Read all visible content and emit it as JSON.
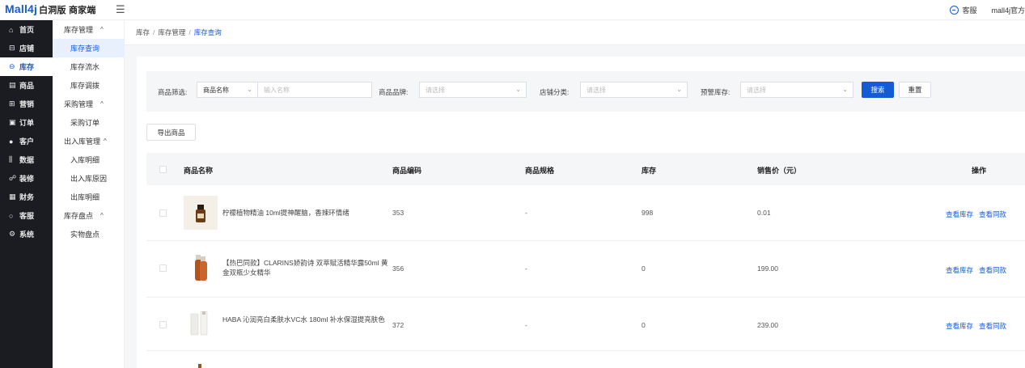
{
  "header": {
    "logo_brand": "Mall4j",
    "logo_sub": "白洞版 商家端",
    "menu_icon": "☰",
    "service_label": "客服",
    "user_name": "mall4j官方"
  },
  "sidebar": {
    "items": [
      {
        "icon": "⌂",
        "label": "首页",
        "active": false
      },
      {
        "icon": "⊟",
        "label": "店铺",
        "active": false
      },
      {
        "icon": "⊖",
        "label": "库存",
        "active": true
      },
      {
        "icon": "▤",
        "label": "商品",
        "active": false
      },
      {
        "icon": "⊞",
        "label": "营销",
        "active": false
      },
      {
        "icon": "▣",
        "label": "订单",
        "active": false
      },
      {
        "icon": "●",
        "label": "客户",
        "active": false
      },
      {
        "icon": "⫼",
        "label": "数据",
        "active": false
      },
      {
        "icon": "☍",
        "label": "装修",
        "active": false
      },
      {
        "icon": "▦",
        "label": "财务",
        "active": false
      },
      {
        "icon": "○",
        "label": "客服",
        "active": false
      },
      {
        "icon": "⚙",
        "label": "系统",
        "active": false
      }
    ]
  },
  "subnav": {
    "caret": "^",
    "groups": [
      {
        "label": "库存管理",
        "items": [
          "库存查询",
          "库存流水",
          "库存调拨"
        ]
      },
      {
        "label": "采购管理",
        "items": [
          "采购订单"
        ]
      },
      {
        "label": "出入库管理",
        "items": [
          "入库明细",
          "出入库原因",
          "出库明细"
        ]
      },
      {
        "label": "库存盘点",
        "items": [
          "实物盘点"
        ]
      }
    ],
    "active_item": "库存查询"
  },
  "breadcrumb": {
    "items": [
      "库存",
      "库存管理",
      "库存查询"
    ],
    "separator": "/"
  },
  "filter": {
    "product_filter_label": "商品筛选:",
    "product_filter_select": "商品名称",
    "product_filter_placeholder": "输入名称",
    "brand_label": "商品品牌:",
    "brand_placeholder": "请选择",
    "shop_category_label": "店铺分类:",
    "shop_category_placeholder": "请选择",
    "warning_stock_label": "预警库存:",
    "warning_stock_placeholder": "请选择",
    "search_button": "搜索",
    "reset_button": "重置",
    "chevron": "⌄"
  },
  "toolbar": {
    "export_button": "导出商品"
  },
  "table": {
    "columns": [
      "商品名称",
      "商品编码",
      "商品规格",
      "库存",
      "销售价（元）",
      "操作"
    ],
    "rows": [
      {
        "name": "柠檬植物精油 10ml提神醒脑，香辣环情绪",
        "code": "353",
        "spec": "-",
        "stock": "998",
        "price": "0.01",
        "actions": [
          "查看库存",
          "查看同款"
        ]
      },
      {
        "name": "【热巴同款】CLARINS娇韵诗 双萃赋活精华露50ml 黄金双瓶少女精华",
        "code": "356",
        "spec": "-",
        "stock": "0",
        "price": "199.00",
        "actions": [
          "查看库存",
          "查看同款"
        ]
      },
      {
        "name": "HABA 沁润亮白柔肤水VC水 180ml 补水保湿提亮肤色",
        "code": "372",
        "spec": "-",
        "stock": "0",
        "price": "239.00",
        "actions": [
          "查看库存",
          "查看同款"
        ]
      }
    ]
  },
  "colors": {
    "accent": "#155bd4",
    "sidebar_bg": "#1b1c22"
  }
}
